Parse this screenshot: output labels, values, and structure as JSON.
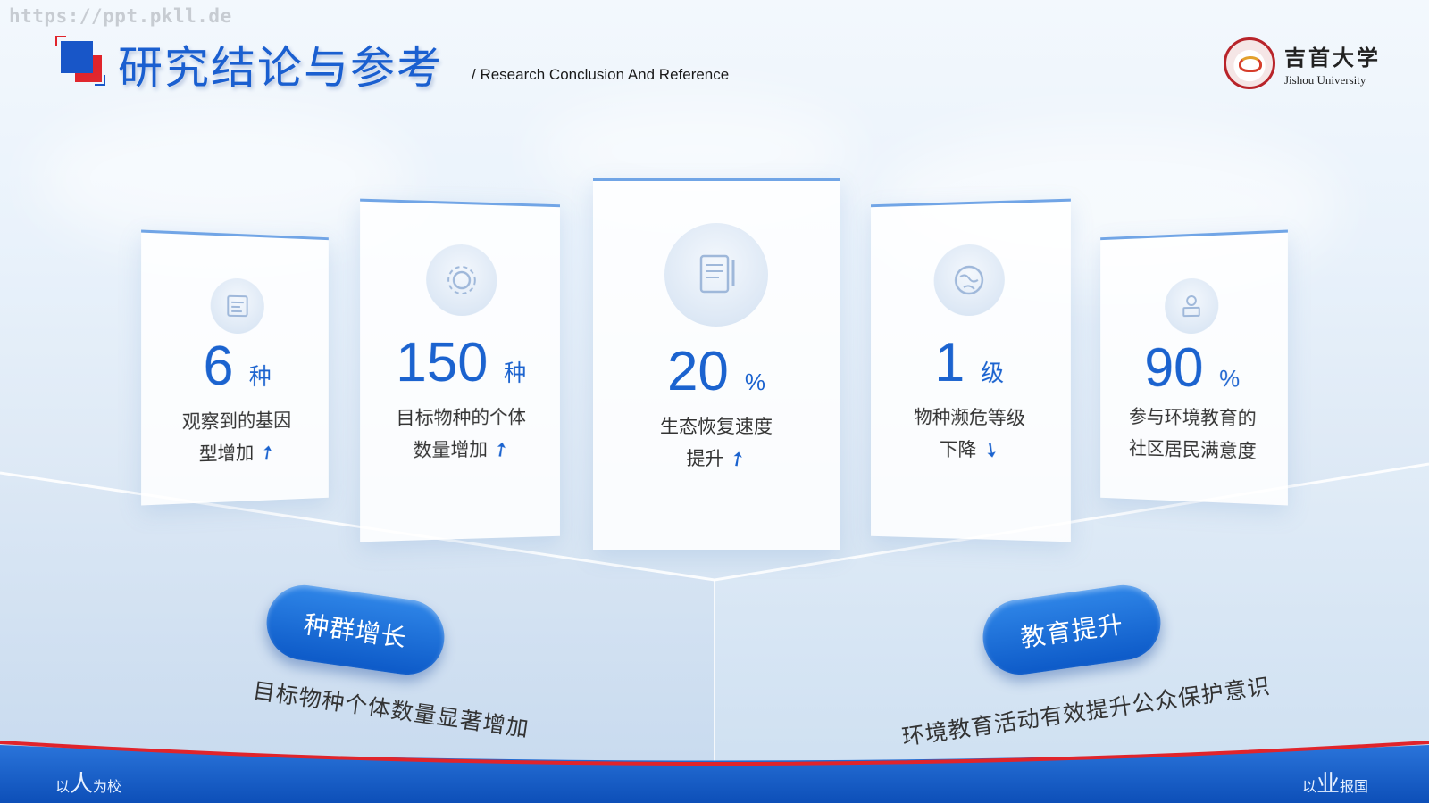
{
  "watermark": "https://ppt.pkll.de",
  "header": {
    "title": "研究结论与参考",
    "subtitle": "/ Research Conclusion And Reference"
  },
  "logo": {
    "cn": "吉首大学",
    "en": "Jishou University"
  },
  "cards": [
    {
      "icon": "document-icon",
      "value": "6",
      "unit": "种",
      "line1": "观察到的基因",
      "line2": "型增加",
      "trend": "up"
    },
    {
      "icon": "gear-icon",
      "value": "150",
      "unit": "种",
      "line1": "目标物种的个体",
      "line2": "数量增加",
      "trend": "up"
    },
    {
      "icon": "tablet-icon",
      "value": "20",
      "unit": "%",
      "line1": "生态恢复速度",
      "line2": "提升",
      "trend": "up"
    },
    {
      "icon": "globe-icon",
      "value": "1",
      "unit": "级",
      "line1": "物种濒危等级",
      "line2": "下降",
      "trend": "down"
    },
    {
      "icon": "person-laptop-icon",
      "value": "90",
      "unit": "%",
      "line1": "参与环境教育的",
      "line2": "社区居民满意度",
      "trend": ""
    }
  ],
  "highlights": [
    {
      "label": "种群增长",
      "desc": "目标物种个体数量显著增加"
    },
    {
      "label": "教育提升",
      "desc": "环境教育活动有效提升公众保护意识"
    }
  ],
  "footer": {
    "left_pre": "以",
    "left_big": "人",
    "left_post": "为校",
    "right_pre": "以",
    "right_big": "业",
    "right_post": "报国"
  },
  "colors": {
    "accent": "#1b63cf",
    "red": "#e0242b",
    "band": "#1356c0"
  }
}
